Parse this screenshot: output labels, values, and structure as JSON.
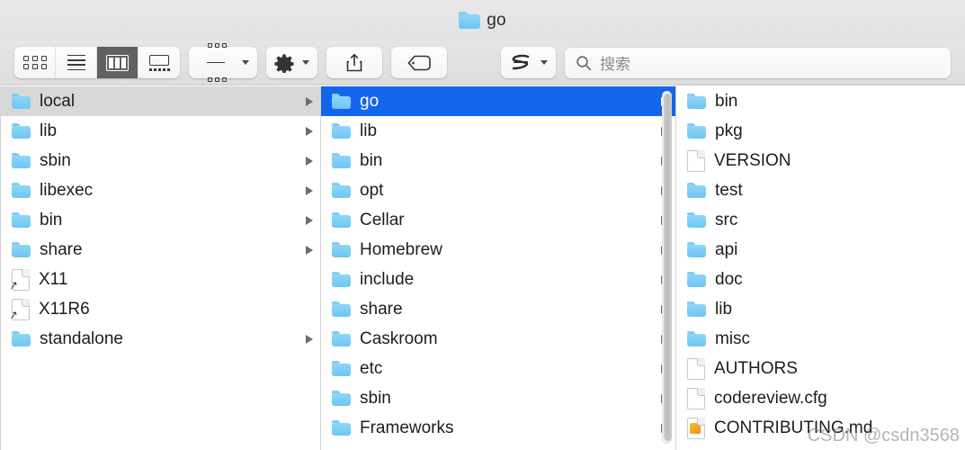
{
  "window": {
    "title": "go",
    "title_icon": "folder-icon"
  },
  "toolbar": {
    "view_modes": [
      {
        "name": "icon-view",
        "label": "Icon View",
        "active": false
      },
      {
        "name": "list-view",
        "label": "List View",
        "active": false
      },
      {
        "name": "column-view",
        "label": "Column View",
        "active": true
      },
      {
        "name": "gallery-view",
        "label": "Gallery View",
        "active": false
      }
    ],
    "group_button": {
      "icon": "group-by-icon",
      "chevron": "chevron-down-icon"
    },
    "action_button": {
      "icon": "gear-icon",
      "chevron": "chevron-down-icon"
    },
    "share_button": {
      "icon": "share-icon"
    },
    "tag_button": {
      "icon": "tag-icon"
    },
    "extension_button": {
      "icon": "s-app-icon",
      "chevron": "chevron-down-icon"
    },
    "search": {
      "icon": "search-icon",
      "placeholder": "搜索",
      "value": ""
    }
  },
  "columns": [
    {
      "name": "column-1",
      "items": [
        {
          "label": "local",
          "kind": "folder",
          "arrow": true,
          "state": "selected-inactive"
        },
        {
          "label": "lib",
          "kind": "folder",
          "arrow": true,
          "state": "normal"
        },
        {
          "label": "sbin",
          "kind": "folder",
          "arrow": true,
          "state": "normal"
        },
        {
          "label": "libexec",
          "kind": "folder",
          "arrow": true,
          "state": "normal"
        },
        {
          "label": "bin",
          "kind": "folder",
          "arrow": true,
          "state": "normal"
        },
        {
          "label": "share",
          "kind": "folder",
          "arrow": true,
          "state": "normal"
        },
        {
          "label": "X11",
          "kind": "alias",
          "arrow": false,
          "state": "normal"
        },
        {
          "label": "X11R6",
          "kind": "alias",
          "arrow": false,
          "state": "normal"
        },
        {
          "label": "standalone",
          "kind": "folder",
          "arrow": true,
          "state": "normal"
        }
      ]
    },
    {
      "name": "column-2",
      "has_scrollbar": true,
      "items": [
        {
          "label": "go",
          "kind": "folder",
          "arrow": true,
          "state": "selected-active"
        },
        {
          "label": "lib",
          "kind": "folder",
          "arrow": true,
          "state": "normal"
        },
        {
          "label": "bin",
          "kind": "folder",
          "arrow": true,
          "state": "normal"
        },
        {
          "label": "opt",
          "kind": "folder",
          "arrow": true,
          "state": "normal"
        },
        {
          "label": "Cellar",
          "kind": "folder",
          "arrow": true,
          "state": "normal"
        },
        {
          "label": "Homebrew",
          "kind": "folder",
          "arrow": true,
          "state": "normal"
        },
        {
          "label": "include",
          "kind": "folder",
          "arrow": true,
          "state": "normal"
        },
        {
          "label": "share",
          "kind": "folder",
          "arrow": true,
          "state": "normal"
        },
        {
          "label": "Caskroom",
          "kind": "folder",
          "arrow": true,
          "state": "normal"
        },
        {
          "label": "etc",
          "kind": "folder",
          "arrow": true,
          "state": "normal"
        },
        {
          "label": "sbin",
          "kind": "folder",
          "arrow": true,
          "state": "normal"
        },
        {
          "label": "Frameworks",
          "kind": "folder",
          "arrow": true,
          "state": "normal"
        }
      ]
    },
    {
      "name": "column-3",
      "items": [
        {
          "label": "bin",
          "kind": "folder",
          "arrow": false,
          "state": "normal"
        },
        {
          "label": "pkg",
          "kind": "folder",
          "arrow": false,
          "state": "normal"
        },
        {
          "label": "VERSION",
          "kind": "document",
          "arrow": false,
          "state": "normal"
        },
        {
          "label": "test",
          "kind": "folder",
          "arrow": false,
          "state": "normal"
        },
        {
          "label": "src",
          "kind": "folder",
          "arrow": false,
          "state": "normal"
        },
        {
          "label": "api",
          "kind": "folder",
          "arrow": false,
          "state": "normal"
        },
        {
          "label": "doc",
          "kind": "folder",
          "arrow": false,
          "state": "normal"
        },
        {
          "label": "lib",
          "kind": "folder",
          "arrow": false,
          "state": "normal"
        },
        {
          "label": "misc",
          "kind": "folder",
          "arrow": false,
          "state": "normal"
        },
        {
          "label": "AUTHORS",
          "kind": "document",
          "arrow": false,
          "state": "normal"
        },
        {
          "label": "codereview.cfg",
          "kind": "document",
          "arrow": false,
          "state": "normal"
        },
        {
          "label": "CONTRIBUTING.md",
          "kind": "markdown",
          "arrow": false,
          "state": "normal"
        }
      ]
    }
  ],
  "watermark": {
    "text": "CSDN @csdn3568"
  },
  "colors": {
    "selection_active": "#1266ec",
    "selection_inactive": "#d8d8d8",
    "folder_blue": "#7ecdf5",
    "toolbar_bg": "#e3e2e2"
  }
}
